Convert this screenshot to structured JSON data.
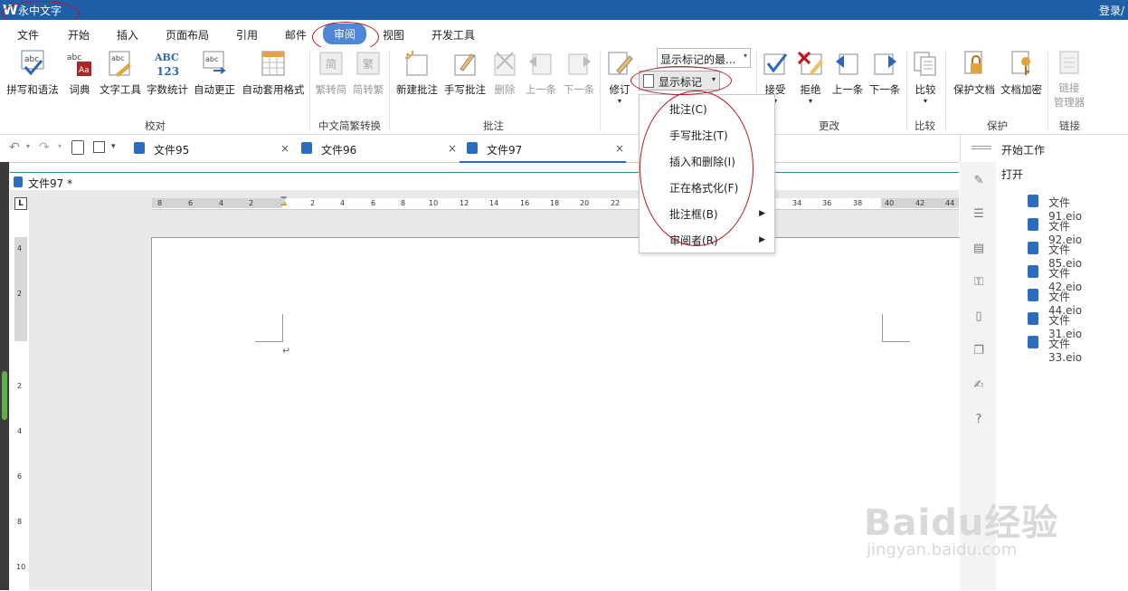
{
  "app": {
    "title": "永中文字",
    "login": "登录/"
  },
  "menubar": {
    "items": [
      "文件",
      "开始",
      "插入",
      "页面布局",
      "引用",
      "邮件",
      "审阅",
      "视图",
      "开发工具"
    ],
    "active": "审阅"
  },
  "ribbon": {
    "proofing": {
      "buttons": [
        "拼写和语法",
        "词典",
        "文字工具",
        "字数统计",
        "自动更正",
        "自动套用格式"
      ],
      "label": "校对"
    },
    "chinese_conversion": {
      "buttons": [
        "繁转简",
        "简转繁"
      ],
      "label": "中文简繁转换"
    },
    "comments": {
      "buttons": [
        "新建批注",
        "手写批注",
        "删除",
        "上一条",
        "下一条"
      ],
      "label": "批注"
    },
    "tracking": {
      "revise": "修订",
      "markup_dropdown": "显示标记的最...",
      "show_markup": "显示标记"
    },
    "changes": {
      "buttons": [
        "接受",
        "拒绝",
        "上一条",
        "下一条"
      ],
      "label": "更改"
    },
    "compare": {
      "buttons": [
        "比较"
      ],
      "label": "比较"
    },
    "protect": {
      "buttons": [
        "保护文档",
        "文档加密"
      ],
      "label": "保护"
    },
    "link": {
      "button_line1": "链接",
      "button_line2": "管理器",
      "label": "链接"
    }
  },
  "tabs": [
    {
      "label": "文件95"
    },
    {
      "label": "文件96"
    },
    {
      "label": "文件97"
    }
  ],
  "doc_path": "文件97 *",
  "ruler": {
    "ticks": [
      "8",
      "6",
      "4",
      "2",
      "2",
      "4",
      "6",
      "8",
      "10",
      "12",
      "14",
      "16",
      "18",
      "20",
      "22",
      "34",
      "36",
      "38",
      "40",
      "42",
      "44"
    ]
  },
  "vruler": {
    "ticks": [
      "4",
      "2",
      "2",
      "4",
      "6",
      "8",
      "10"
    ]
  },
  "paragraph_mark": "↵",
  "dropdown": {
    "items": [
      {
        "label": "批注(C)",
        "submenu": false
      },
      {
        "label": "手写批注(T)",
        "submenu": false
      },
      {
        "label": "插入和删除(I)",
        "submenu": false
      },
      {
        "label": "正在格式化(F)",
        "submenu": false
      },
      {
        "label": "批注框(B)",
        "submenu": true
      },
      {
        "label": "审阅者(R)",
        "submenu": true
      }
    ]
  },
  "sidebar": {
    "heading": "开始工作",
    "open": "打开",
    "recent_files": [
      "文件91.eio",
      "文件92.eio",
      "文件85.eio",
      "文件42.eio",
      "文件44.eio",
      "文件31.eio",
      "文件33.eio"
    ]
  },
  "watermark": {
    "line1": "Baidu经验",
    "line2": "jingyan.baidu.com"
  },
  "colors": {
    "titlebar": "#1f5ea8",
    "accent": "#4e86d8",
    "annotation_red": "#c0141c"
  }
}
